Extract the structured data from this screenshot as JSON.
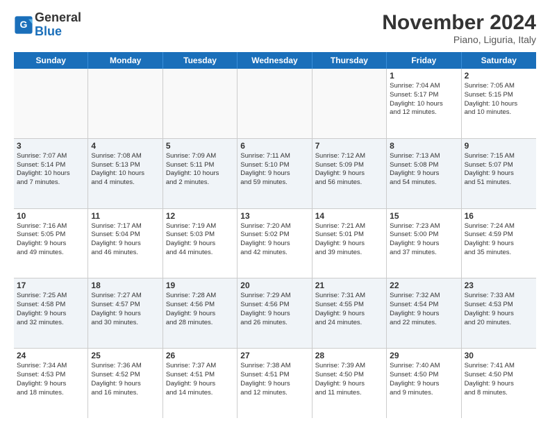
{
  "logo": {
    "line1": "General",
    "line2": "Blue"
  },
  "header": {
    "month": "November 2024",
    "location": "Piano, Liguria, Italy"
  },
  "weekdays": [
    "Sunday",
    "Monday",
    "Tuesday",
    "Wednesday",
    "Thursday",
    "Friday",
    "Saturday"
  ],
  "rows": [
    [
      {
        "day": "",
        "text": ""
      },
      {
        "day": "",
        "text": ""
      },
      {
        "day": "",
        "text": ""
      },
      {
        "day": "",
        "text": ""
      },
      {
        "day": "",
        "text": ""
      },
      {
        "day": "1",
        "text": "Sunrise: 7:04 AM\nSunset: 5:17 PM\nDaylight: 10 hours\nand 12 minutes."
      },
      {
        "day": "2",
        "text": "Sunrise: 7:05 AM\nSunset: 5:15 PM\nDaylight: 10 hours\nand 10 minutes."
      }
    ],
    [
      {
        "day": "3",
        "text": "Sunrise: 7:07 AM\nSunset: 5:14 PM\nDaylight: 10 hours\nand 7 minutes."
      },
      {
        "day": "4",
        "text": "Sunrise: 7:08 AM\nSunset: 5:13 PM\nDaylight: 10 hours\nand 4 minutes."
      },
      {
        "day": "5",
        "text": "Sunrise: 7:09 AM\nSunset: 5:11 PM\nDaylight: 10 hours\nand 2 minutes."
      },
      {
        "day": "6",
        "text": "Sunrise: 7:11 AM\nSunset: 5:10 PM\nDaylight: 9 hours\nand 59 minutes."
      },
      {
        "day": "7",
        "text": "Sunrise: 7:12 AM\nSunset: 5:09 PM\nDaylight: 9 hours\nand 56 minutes."
      },
      {
        "day": "8",
        "text": "Sunrise: 7:13 AM\nSunset: 5:08 PM\nDaylight: 9 hours\nand 54 minutes."
      },
      {
        "day": "9",
        "text": "Sunrise: 7:15 AM\nSunset: 5:07 PM\nDaylight: 9 hours\nand 51 minutes."
      }
    ],
    [
      {
        "day": "10",
        "text": "Sunrise: 7:16 AM\nSunset: 5:05 PM\nDaylight: 9 hours\nand 49 minutes."
      },
      {
        "day": "11",
        "text": "Sunrise: 7:17 AM\nSunset: 5:04 PM\nDaylight: 9 hours\nand 46 minutes."
      },
      {
        "day": "12",
        "text": "Sunrise: 7:19 AM\nSunset: 5:03 PM\nDaylight: 9 hours\nand 44 minutes."
      },
      {
        "day": "13",
        "text": "Sunrise: 7:20 AM\nSunset: 5:02 PM\nDaylight: 9 hours\nand 42 minutes."
      },
      {
        "day": "14",
        "text": "Sunrise: 7:21 AM\nSunset: 5:01 PM\nDaylight: 9 hours\nand 39 minutes."
      },
      {
        "day": "15",
        "text": "Sunrise: 7:23 AM\nSunset: 5:00 PM\nDaylight: 9 hours\nand 37 minutes."
      },
      {
        "day": "16",
        "text": "Sunrise: 7:24 AM\nSunset: 4:59 PM\nDaylight: 9 hours\nand 35 minutes."
      }
    ],
    [
      {
        "day": "17",
        "text": "Sunrise: 7:25 AM\nSunset: 4:58 PM\nDaylight: 9 hours\nand 32 minutes."
      },
      {
        "day": "18",
        "text": "Sunrise: 7:27 AM\nSunset: 4:57 PM\nDaylight: 9 hours\nand 30 minutes."
      },
      {
        "day": "19",
        "text": "Sunrise: 7:28 AM\nSunset: 4:56 PM\nDaylight: 9 hours\nand 28 minutes."
      },
      {
        "day": "20",
        "text": "Sunrise: 7:29 AM\nSunset: 4:56 PM\nDaylight: 9 hours\nand 26 minutes."
      },
      {
        "day": "21",
        "text": "Sunrise: 7:31 AM\nSunset: 4:55 PM\nDaylight: 9 hours\nand 24 minutes."
      },
      {
        "day": "22",
        "text": "Sunrise: 7:32 AM\nSunset: 4:54 PM\nDaylight: 9 hours\nand 22 minutes."
      },
      {
        "day": "23",
        "text": "Sunrise: 7:33 AM\nSunset: 4:53 PM\nDaylight: 9 hours\nand 20 minutes."
      }
    ],
    [
      {
        "day": "24",
        "text": "Sunrise: 7:34 AM\nSunset: 4:53 PM\nDaylight: 9 hours\nand 18 minutes."
      },
      {
        "day": "25",
        "text": "Sunrise: 7:36 AM\nSunset: 4:52 PM\nDaylight: 9 hours\nand 16 minutes."
      },
      {
        "day": "26",
        "text": "Sunrise: 7:37 AM\nSunset: 4:51 PM\nDaylight: 9 hours\nand 14 minutes."
      },
      {
        "day": "27",
        "text": "Sunrise: 7:38 AM\nSunset: 4:51 PM\nDaylight: 9 hours\nand 12 minutes."
      },
      {
        "day": "28",
        "text": "Sunrise: 7:39 AM\nSunset: 4:50 PM\nDaylight: 9 hours\nand 11 minutes."
      },
      {
        "day": "29",
        "text": "Sunrise: 7:40 AM\nSunset: 4:50 PM\nDaylight: 9 hours\nand 9 minutes."
      },
      {
        "day": "30",
        "text": "Sunrise: 7:41 AM\nSunset: 4:50 PM\nDaylight: 9 hours\nand 8 minutes."
      }
    ]
  ]
}
